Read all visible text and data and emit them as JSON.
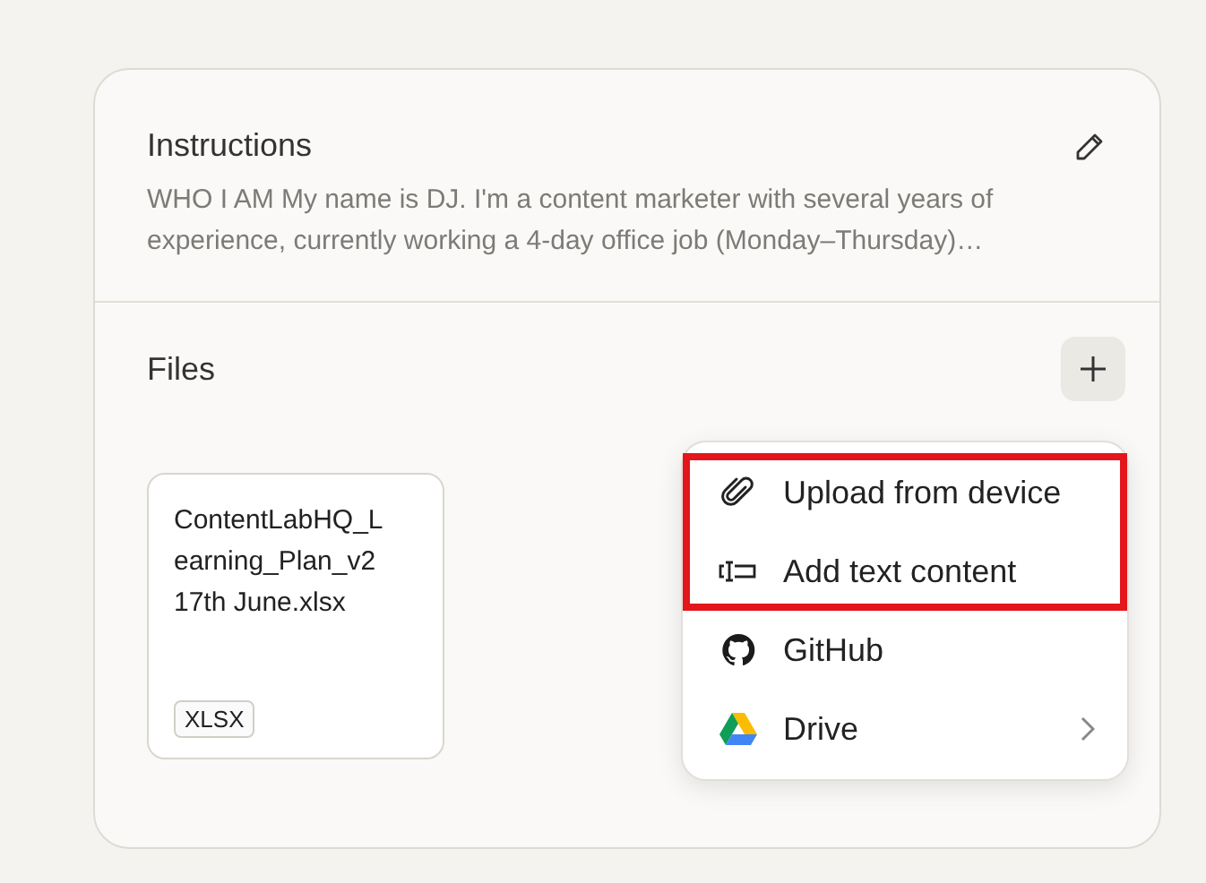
{
  "instructions": {
    "title": "Instructions",
    "text": "WHO I AM My name is DJ. I'm a content marketer with several years of experience, currently working a 4-day office job (Monday–Thursday)…"
  },
  "files": {
    "title": "Files",
    "items": [
      {
        "name": "ContentLabHQ_Learning_Plan_v2 17th June.xlsx",
        "type": "XLSX"
      }
    ]
  },
  "menu": {
    "items": [
      {
        "kind": "upload",
        "label": "Upload from device",
        "submenu": false,
        "highlighted": true
      },
      {
        "kind": "text",
        "label": "Add text content",
        "submenu": false,
        "highlighted": true
      },
      {
        "kind": "github",
        "label": "GitHub",
        "submenu": false,
        "highlighted": false
      },
      {
        "kind": "drive",
        "label": "Drive",
        "submenu": true,
        "highlighted": false
      }
    ]
  }
}
